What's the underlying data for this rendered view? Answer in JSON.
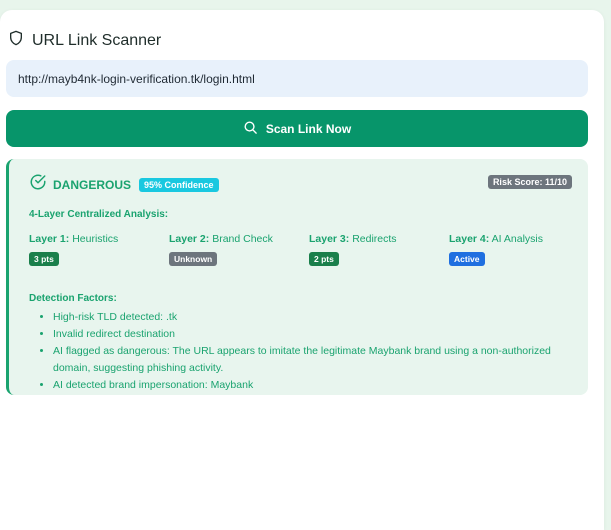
{
  "app": {
    "title": "URL Link Scanner"
  },
  "input": {
    "value": "http://mayb4nk-login-verification.tk/login.html"
  },
  "scan_button": {
    "label": "Scan Link Now"
  },
  "result": {
    "status": "DANGEROUS",
    "confidence": "95% Confidence",
    "risk_score": "Risk Score: 11/10",
    "analysis_title": "4-Layer Centralized Analysis:",
    "layers": [
      {
        "prefix": "Layer 1:",
        "name": "Heuristics",
        "badge": "3 pts",
        "badge_color": "#1a7f4b"
      },
      {
        "prefix": "Layer 2:",
        "name": "Brand Check",
        "badge": "Unknown",
        "badge_color": "#6d757d"
      },
      {
        "prefix": "Layer 3:",
        "name": "Redirects",
        "badge": "2 pts",
        "badge_color": "#1a7f4b"
      },
      {
        "prefix": "Layer 4:",
        "name": "AI Analysis",
        "badge": "Active",
        "badge_color": "#1f6fe0"
      }
    ],
    "factors_title": "Detection Factors:",
    "factors": [
      "High-risk TLD detected: .tk",
      "Invalid redirect destination",
      "AI flagged as dangerous: The URL appears to imitate the legitimate Maybank brand using a non-authorized domain, suggesting phishing activity.",
      "AI detected brand impersonation: Maybank"
    ]
  },
  "icons": {
    "header": "shield-icon",
    "button": "search-icon",
    "status": "check-circle-icon"
  },
  "colors": {
    "primary": "#07956a",
    "accent_green": "#1aa36f",
    "result_bg": "#e8f5ee",
    "input_bg": "#e8f1fb",
    "confidence": "#19c8e0",
    "risk": "#6d757d"
  }
}
